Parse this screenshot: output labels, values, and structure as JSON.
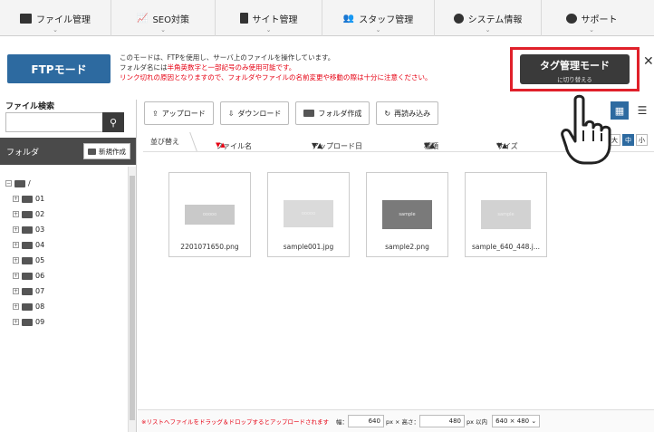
{
  "nav": [
    {
      "label": "ファイル管理",
      "icon": "image-icon"
    },
    {
      "label": "SEO対策",
      "icon": "chart-icon"
    },
    {
      "label": "サイト管理",
      "icon": "site-icon"
    },
    {
      "label": "スタッフ管理",
      "icon": "people-icon"
    },
    {
      "label": "システム情報",
      "icon": "gear-icon"
    },
    {
      "label": "サポート",
      "icon": "support-icon"
    }
  ],
  "mode": {
    "ftp_button": "FTPモード",
    "desc_line1": "このモードは、FTPを使用し、サーバ上のファイルを操作しています。",
    "desc_line2_a": "フォルダ名には",
    "desc_line2_b": "半角英数字と一部記号のみ使用可能です。",
    "desc_line3": "リンク切れの原因となりますので、フォルダやファイルの名前変更や移動の際は十分に注意ください。",
    "tag_button_main": "タグ管理モード",
    "tag_button_sub": "に切り替える",
    "close": "✕"
  },
  "left": {
    "search_label": "ファイル検索",
    "search_value": "",
    "folder_title": "フォルダ",
    "new_folder": "新規作成",
    "root": "/",
    "folders": [
      "01",
      "02",
      "03",
      "04",
      "05",
      "06",
      "07",
      "08",
      "09"
    ]
  },
  "toolbar": {
    "upload": "アップロード",
    "download": "ダウンロード",
    "create_folder": "フォルダ作成",
    "reload": "再読み込み"
  },
  "sort": {
    "label": "並び替え",
    "filename": "ファイル名",
    "upload_date": "アップロード日",
    "type": "種類",
    "size": "サイズ",
    "arrows": "▼▲",
    "size_options": [
      "大",
      "中",
      "小"
    ],
    "size_selected": "中"
  },
  "files": [
    {
      "name": "2201071650.png",
      "thumb_text": "ooooo"
    },
    {
      "name": "sample001.jpg",
      "thumb_text": "ooooo"
    },
    {
      "name": "sample2.png",
      "thumb_text": "sample"
    },
    {
      "name": "sample_640_448.j...",
      "thumb_text": "sample"
    }
  ],
  "bottom": {
    "hint": "※リストへファイルをドラッグ＆ドロップするとアップロードされます",
    "width_label": "幅：",
    "width_value": "640",
    "width_unit": "px × 高さ：",
    "height_value": "480",
    "height_unit": "px 以内",
    "preset": "640 × 480 ⌄"
  }
}
